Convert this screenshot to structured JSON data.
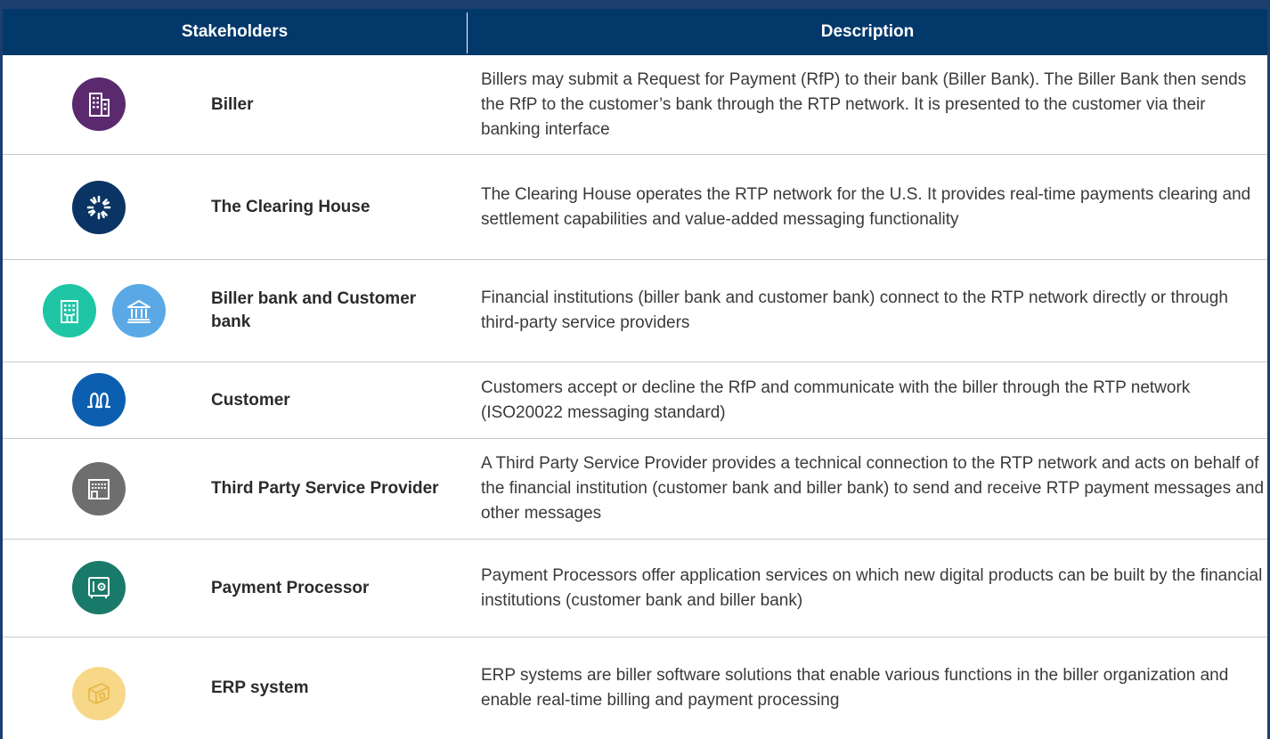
{
  "header": {
    "stakeholders_label": "Stakeholders",
    "description_label": "Description"
  },
  "rows": [
    {
      "name": "Biller",
      "description": "Billers may submit a Request for Payment (RfP) to their bank (Biller Bank). The Biller Bank then sends the RfP to the customer’s bank through the RTP network.  It is presented to the customer via their banking interface",
      "icons": [
        {
          "icon": "office-building-icon",
          "color": "#5b2a6e"
        }
      ]
    },
    {
      "name": "The Clearing House",
      "description": "The Clearing House operates the RTP network for the U.S. It provides real-time payments clearing and settlement capabilities and value-added messaging functionality",
      "icons": [
        {
          "icon": "clearing-house-logo-icon",
          "color": "#0a3464"
        }
      ]
    },
    {
      "name": "Biller bank and Customer bank",
      "description": "Financial institutions (biller bank and customer bank) connect to the RTP network directly or through third-party service providers",
      "icons": [
        {
          "icon": "bank-building-icon",
          "color": "#1ec6a6"
        },
        {
          "icon": "bank-columns-icon",
          "color": "#5aa9e6"
        }
      ]
    },
    {
      "name": "Customer",
      "description": "Customers accept or decline the RfP and communicate with the biller through the RTP network (ISO20022 messaging standard)",
      "icons": [
        {
          "icon": "people-icon",
          "color": "#0c5fb0"
        }
      ]
    },
    {
      "name": "Third Party Service Provider",
      "description": "A Third Party Service Provider provides a technical connection to the RTP network and acts on behalf of the financial institution (customer bank and biller bank) to send and receive RTP payment messages and other messages",
      "icons": [
        {
          "icon": "facility-icon",
          "color": "#6e6e6e"
        }
      ]
    },
    {
      "name": "Payment Processor",
      "description": "Payment Processors offer application services on which new digital products can be built by the financial institutions (customer bank and biller bank)",
      "icons": [
        {
          "icon": "safe-icon",
          "color": "#1a7a6a"
        }
      ]
    },
    {
      "name": "ERP system",
      "description": "ERP systems are biller software solutions that enable various functions in the biller organization and enable real-time billing and payment processing",
      "icons": [
        {
          "icon": "box-icon",
          "color": "#f7d889"
        }
      ]
    }
  ]
}
